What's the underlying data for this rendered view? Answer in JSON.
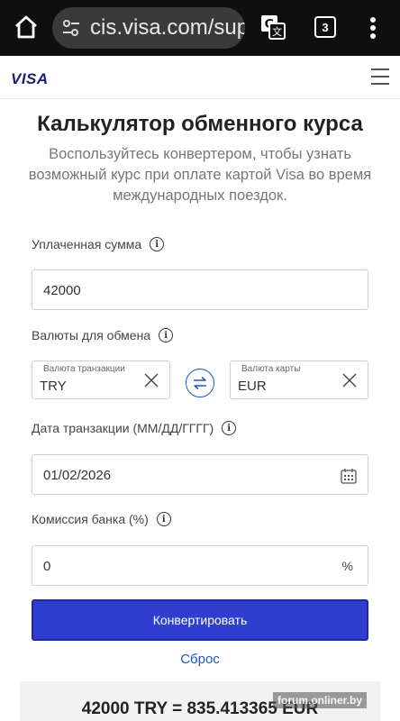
{
  "browser": {
    "url": "cis.visa.com/sup",
    "tab_count": "3",
    "background_color": "#0f0f0f",
    "icons": {
      "home": "home-icon",
      "site_settings": "tune-icon",
      "translate": "translate-icon",
      "menu": "more-vert-icon"
    }
  },
  "header": {
    "logo": "VISA",
    "menu_icon": "hamburger-icon"
  },
  "page": {
    "title": "Калькулятор обменного курса",
    "subtitle": "Воспользуйтесь конвертером, чтобы узнать возможный курс при оплате картой Visa во время международных поездок."
  },
  "form": {
    "amount": {
      "label": "Уплаченная сумма",
      "value": "42000"
    },
    "currencies": {
      "label": "Валюты для обмена",
      "from": {
        "mini_label": "Валюта транзакции",
        "value": "TRY"
      },
      "to": {
        "mini_label": "Валюта карты",
        "value": "EUR"
      }
    },
    "date": {
      "label": "Дата транзакции (ММ/ДД/ГГГГ)",
      "value": "01/02/2026"
    },
    "fee": {
      "label": "Комиссия банка (%)",
      "value": "0",
      "suffix": "%"
    },
    "convert_label": "Конвертировать",
    "reset_label": "Сброс"
  },
  "result": {
    "text": "42000 TRY = 835.413365 EUR"
  },
  "watermark": "forum.onliner.by",
  "colors": {
    "accent_blue": "#2e3ecf",
    "link_blue": "#1a56c4",
    "visa_navy": "#1a1f71"
  }
}
